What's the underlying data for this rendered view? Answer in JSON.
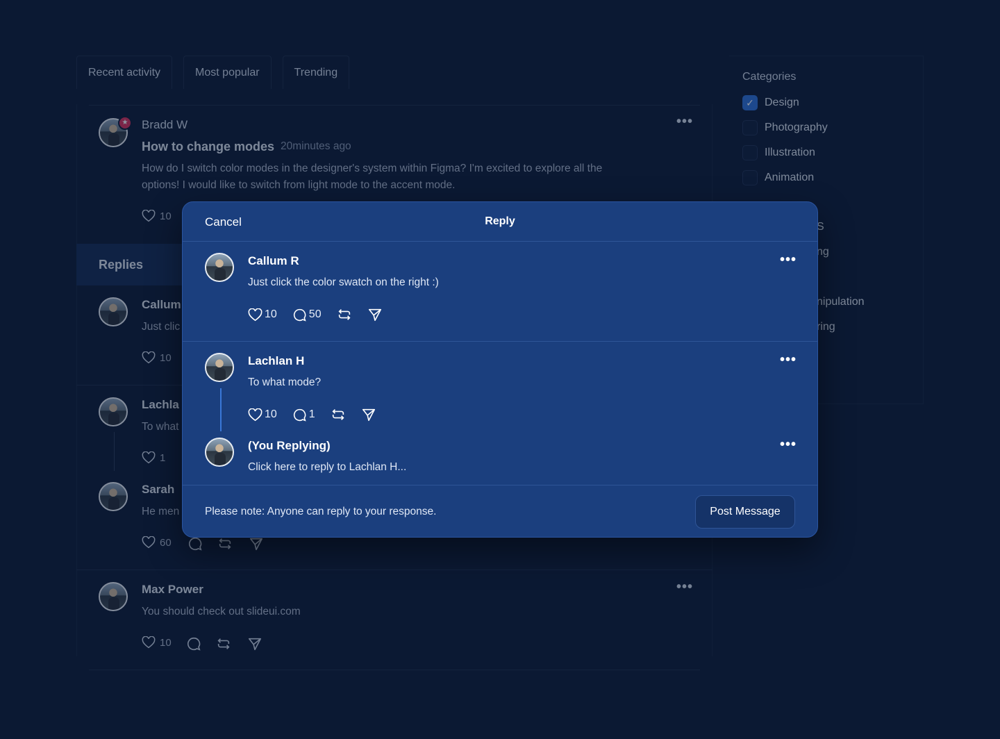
{
  "tabs": [
    "Recent activity",
    "Most popular",
    "Trending"
  ],
  "feed": {
    "post": {
      "author": "Bradd W",
      "title": "How to change modes",
      "time": "20minutes ago",
      "body_line1": "How do I switch color modes in the designer's system within Figma? I'm excited to explore all the",
      "body_line2": "options! I would like to switch from light mode to the accent mode.",
      "likes": "10"
    },
    "replies_label": "Replies",
    "replies": [
      {
        "name": "Callum",
        "text": "Just clic",
        "likes": "10"
      },
      {
        "name": "Lachla",
        "text": "To what",
        "likes": "1"
      },
      {
        "name": "Sarah",
        "text": "He men",
        "likes": "60"
      },
      {
        "name": "Max Power",
        "text": "You should check out slideui.com",
        "likes": "10"
      }
    ]
  },
  "sidebar": {
    "title": "Categories",
    "items": [
      {
        "label": "Design",
        "checked": true
      },
      {
        "label": "Photography",
        "checked": false
      },
      {
        "label": "Illustration",
        "checked": false
      },
      {
        "label": "Animation",
        "checked": false
      }
    ],
    "partial": [
      "S",
      "ng",
      "nipulation",
      "ring"
    ]
  },
  "modal": {
    "cancel": "Cancel",
    "title": "Reply",
    "comments": [
      {
        "name": "Callum R",
        "text": "Just click the color swatch on the right :)",
        "likes": "10",
        "comments": "50"
      },
      {
        "name": "Lachlan H",
        "text": "To what mode?",
        "likes": "10",
        "comments": "1"
      }
    ],
    "reply": {
      "name": "(You Replying)",
      "placeholder": "Click here to reply to Lachlan H..."
    },
    "note": "Please note: Anyone can reply to your response.",
    "post_button": "Post Message"
  },
  "icons": [
    "heart-icon",
    "comment-icon",
    "repost-icon",
    "send-icon",
    "more-icon",
    "check-icon",
    "star-icon"
  ],
  "colors": {
    "background": "#0b1933",
    "modal": "#1b3f7e",
    "accent": "#2d6fd6",
    "badge": "#d7305a"
  }
}
